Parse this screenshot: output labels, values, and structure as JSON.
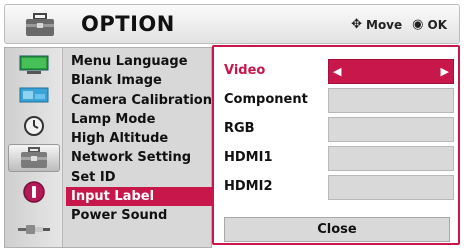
{
  "header": {
    "title": "OPTION",
    "icon": "toolbox-icon",
    "hint_move": "Move",
    "hint_ok": "OK"
  },
  "sidebar_icons": [
    {
      "name": "picture-icon",
      "active": false
    },
    {
      "name": "screen-icon",
      "active": false
    },
    {
      "name": "timer-icon",
      "active": false
    },
    {
      "name": "toolbox-icon",
      "active": true
    },
    {
      "name": "info-icon",
      "active": false
    },
    {
      "name": "input-cable-icon",
      "active": false
    }
  ],
  "menu": {
    "items": [
      {
        "label": "Menu Language"
      },
      {
        "label": "Blank Image"
      },
      {
        "label": "Camera Calibration"
      },
      {
        "label": "Lamp Mode"
      },
      {
        "label": "High Altitude"
      },
      {
        "label": "Network Setting"
      },
      {
        "label": "Set ID"
      },
      {
        "label": "Input Label"
      },
      {
        "label": "Power Sound"
      }
    ],
    "selected": "Input Label"
  },
  "popup": {
    "rows": [
      {
        "label": "Video",
        "value": ""
      },
      {
        "label": "Component",
        "value": ""
      },
      {
        "label": "RGB",
        "value": ""
      },
      {
        "label": "HDMI1",
        "value": ""
      },
      {
        "label": "HDMI2",
        "value": ""
      }
    ],
    "active_row": "Video",
    "close_label": "Close"
  },
  "colors": {
    "accent": "#c8174a",
    "field": "#d9d9d9",
    "panel": "#d8d8d8"
  }
}
